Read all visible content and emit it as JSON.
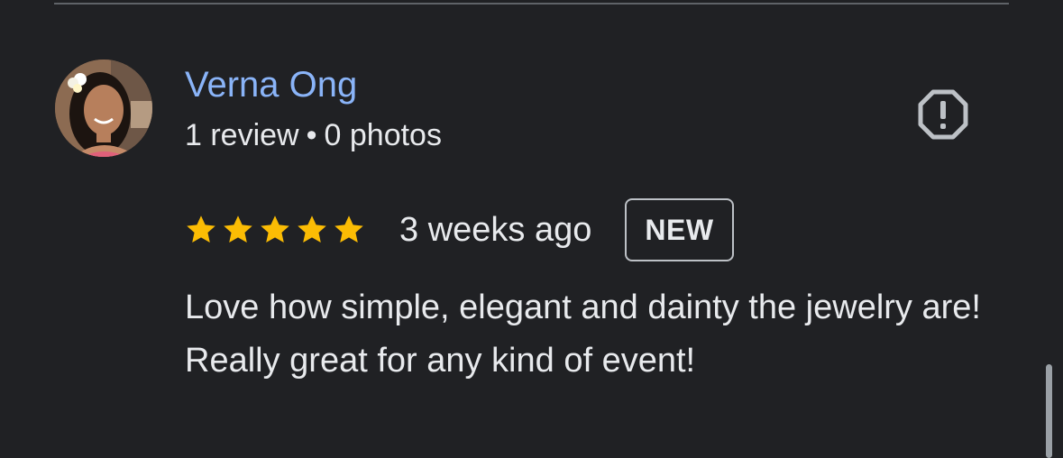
{
  "reviewer": {
    "name": "Verna Ong",
    "reviews_count": "1 review",
    "separator": "•",
    "photos_count": "0 photos"
  },
  "rating": {
    "stars": 5,
    "max_stars": 5,
    "star_color": "#fbbc04"
  },
  "review": {
    "date": "3 weeks ago",
    "badge": "NEW",
    "text": "Love how simple, elegant and dainty the jewelry are! Really great for any kind of event!"
  },
  "icons": {
    "report": "report-flag-icon",
    "star": "star-icon"
  },
  "colors": {
    "background": "#202124",
    "name_link": "#8ab4f8",
    "text": "#e8eaed",
    "divider": "#5f6368"
  }
}
